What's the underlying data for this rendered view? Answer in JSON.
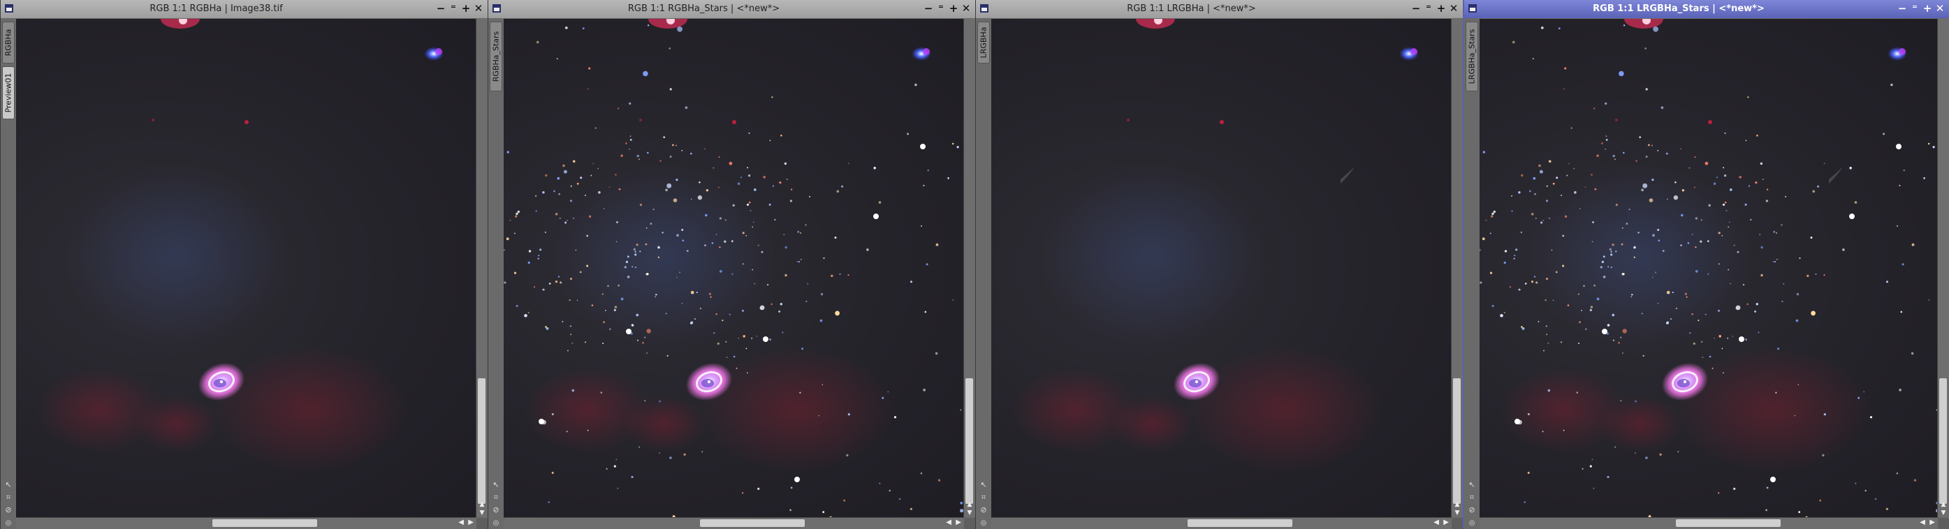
{
  "windows": [
    {
      "title": "RGB 1:1 RGBHa | Image38.tif",
      "tabs": [
        "RGBHa",
        "Preview01"
      ],
      "stars": false,
      "lum": false,
      "active": false,
      "controls": [
        "−",
        "⁼",
        "+",
        "✕"
      ]
    },
    {
      "title": "RGB 1:1 RGBHa_Stars | <*new*>",
      "tabs": [
        "RGBHa_Stars"
      ],
      "stars": true,
      "lum": false,
      "active": false,
      "controls": [
        "−",
        "⁼",
        "+",
        "✕"
      ]
    },
    {
      "title": "RGB 1:1 LRGBHa | <*new*>",
      "tabs": [
        "LRGBHa"
      ],
      "stars": false,
      "lum": true,
      "active": false,
      "controls": [
        "−",
        "⁼",
        "+",
        "✕"
      ]
    },
    {
      "title": "RGB 1:1 LRGBHa_Stars | <*new*>",
      "tabs": [
        "LRGBHa_Stars"
      ],
      "stars": true,
      "lum": true,
      "active": true,
      "controls": [
        "−",
        "⁼",
        "+",
        "✕"
      ]
    }
  ],
  "colors": {
    "active_title": "#5b63b8",
    "nebula_pink": "#d86bd0",
    "nebula_blue": "#5a78ff"
  }
}
